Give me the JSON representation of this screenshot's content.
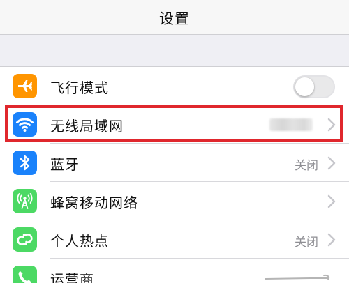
{
  "header": {
    "title": "设置"
  },
  "rows": [
    {
      "label": "飞行模式",
      "icon": "airplane-icon",
      "icon_color": "#ff9500",
      "accessory": "toggle",
      "toggle_on": false
    },
    {
      "label": "无线局域网",
      "icon": "wifi-icon",
      "icon_color": "#1a82fb",
      "accessory": "chevron",
      "detail": ""
    },
    {
      "label": "蓝牙",
      "icon": "bluetooth-icon",
      "icon_color": "#1a82fb",
      "accessory": "chevron",
      "detail": "关闭"
    },
    {
      "label": "蜂窝移动网络",
      "icon": "cellular-antenna-icon",
      "icon_color": "#4cd964",
      "accessory": "chevron",
      "detail": ""
    },
    {
      "label": "个人热点",
      "icon": "hotspot-link-icon",
      "icon_color": "#4cd964",
      "accessory": "chevron",
      "detail": "关闭"
    },
    {
      "label": "运营商",
      "icon": "phone-icon",
      "icon_color": "#4cd964",
      "accessory": "chevron",
      "detail": ""
    }
  ],
  "colors": {
    "highlight": "#e0272d",
    "background": "#efeff4",
    "detail_text": "#8e8e93"
  }
}
